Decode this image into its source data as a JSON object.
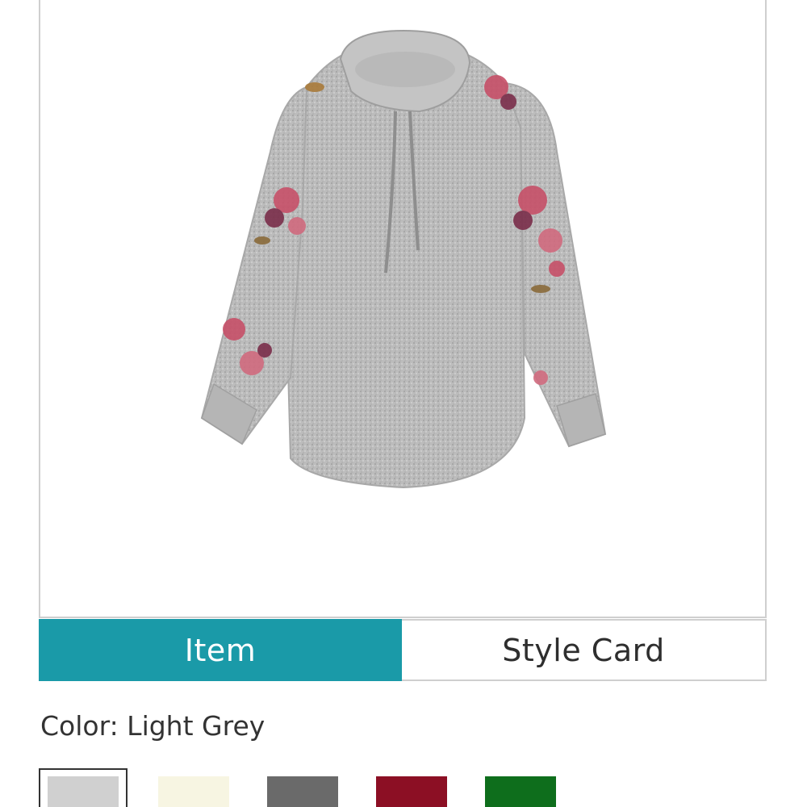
{
  "product": {
    "image_alt": "Grey cowl neck pullover with floral sleeves"
  },
  "tabs": [
    {
      "label": "Item",
      "active": true
    },
    {
      "label": "Style Card",
      "active": false
    }
  ],
  "color": {
    "label": "Color: Light Grey",
    "swatches": [
      {
        "name": "Light Grey",
        "hex": "#d0d0d0",
        "selected": true
      },
      {
        "name": "Cream",
        "hex": "#f7f5e2",
        "selected": false
      },
      {
        "name": "Charcoal",
        "hex": "#6a6a6a",
        "selected": false
      },
      {
        "name": "Burgundy",
        "hex": "#8c0f24",
        "selected": false
      },
      {
        "name": "Green",
        "hex": "#0e6e1c",
        "selected": false
      }
    ]
  },
  "colors": {
    "accent": "#1a9aa8",
    "border": "#cfcfcf"
  }
}
